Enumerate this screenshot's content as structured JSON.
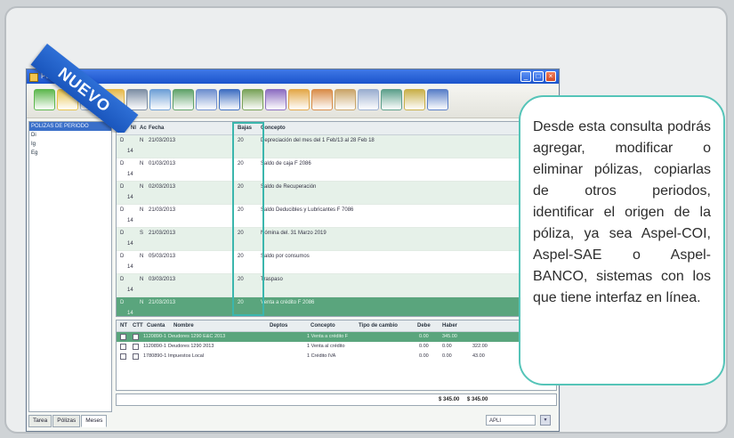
{
  "ribbon": {
    "label": "NUEVO"
  },
  "window": {
    "title": "Pólizas - Ma..."
  },
  "toolbar": {
    "icons": [
      "add-poliza-icon",
      "edit-icon",
      "delete-icon",
      "copy-icon",
      "question-icon",
      "paste-icon",
      "filter-icon",
      "preview-icon",
      "print-icon",
      "export-icon",
      "documents-icon",
      "document-2-icon",
      "document-3-icon",
      "document-4-icon",
      "document-5-icon",
      "refresh-icon",
      "tools-icon",
      "exit-icon"
    ]
  },
  "left_panel": {
    "items": [
      {
        "label": "POLIZAS DE PERIODO",
        "selected": true
      },
      {
        "label": "Di",
        "selected": false
      },
      {
        "label": "Ig",
        "selected": false
      },
      {
        "label": "Eg",
        "selected": false
      }
    ]
  },
  "polizas_grid": {
    "headers": {
      "tipo": "Ty",
      "num": "Nl",
      "dia": "Ac",
      "fecha": "Fecha",
      "bajas": "Bajas",
      "concepto": "Concepto"
    },
    "rows": [
      {
        "tipo": "D",
        "num": "14",
        "dia": "N",
        "fecha": "21/03/2013",
        "bajas": "20",
        "concepto": "Depreciación del mes del 1 Feb/13 al 28 Feb 18"
      },
      {
        "tipo": "D",
        "num": "14",
        "dia": "N",
        "fecha": "01/03/2013",
        "bajas": "20",
        "concepto": "Saldo de caja F 2086"
      },
      {
        "tipo": "D",
        "num": "14",
        "dia": "N",
        "fecha": "02/03/2013",
        "bajas": "20",
        "concepto": "Saldo de Recuperación"
      },
      {
        "tipo": "D",
        "num": "14",
        "dia": "N",
        "fecha": "21/03/2013",
        "bajas": "20",
        "concepto": "Saldo Deducibles y Lubricantes F 7086"
      },
      {
        "tipo": "D",
        "num": "14",
        "dia": "S",
        "fecha": "21/03/2013",
        "bajas": "20",
        "concepto": "Nómina del. 31 Marzo 2019"
      },
      {
        "tipo": "D",
        "num": "14",
        "dia": "N",
        "fecha": "05/03/2013",
        "bajas": "20",
        "concepto": "Saldo por consumos"
      },
      {
        "tipo": "D",
        "num": "14",
        "dia": "N",
        "fecha": "03/03/2013",
        "bajas": "20",
        "concepto": "Traspaso"
      },
      {
        "tipo": "D",
        "num": "14",
        "dia": "N",
        "fecha": "21/03/2013",
        "bajas": "20",
        "concepto": "Venta a crédito F 2086"
      }
    ]
  },
  "movimientos_grid": {
    "headers": {
      "nt": "NT",
      "ctt": "CTT",
      "cuenta": "Cuenta",
      "nombre": "Nombre",
      "deptos": "Deptos",
      "concepto": "Concepto",
      "tipo_cambio": "Tipo de cambio",
      "debe": "Debe",
      "haber": "Haber"
    },
    "rows": [
      {
        "cuenta": "1120890-1",
        "nombre": "Deudores 1290 E&C 2013",
        "concepto": "1 Venta a crédito F",
        "debe": "0.00",
        "haber": "345.00",
        "extra": ""
      },
      {
        "cuenta": "1120890-1",
        "nombre": "Deudores 1290 2013",
        "concepto": "1 Venta al crédito",
        "debe": "0.00",
        "haber": "0.00",
        "extra": "322.00"
      },
      {
        "cuenta": "1780890-1",
        "nombre": "Impuestos Local",
        "concepto": "1 Crédito IVA",
        "debe": "0.00",
        "haber": "0.00",
        "extra": "43.00"
      }
    ]
  },
  "totals": {
    "debe": "$ 345.00",
    "haber": "$ 345.00"
  },
  "tabs": [
    {
      "label": "Tarea",
      "active": false
    },
    {
      "label": "Pólizas",
      "active": false
    },
    {
      "label": "Meses",
      "active": true
    }
  ],
  "status": {
    "field": "APLI"
  },
  "callout": {
    "text": "Desde esta consulta podrás agregar, modificar o eliminar pólizas, copiarlas de otros periodos, identificar el origen de la póliza, ya sea Aspel-COI, Aspel-SAE o Aspel-BANCO, sistemas con los que tiene interfaz en línea."
  },
  "colors": {
    "accent": "#55c4b8",
    "ribbon": "#2e6fd6",
    "selected_row": "#5aa57d",
    "alt_row": "#e6f1e9"
  }
}
